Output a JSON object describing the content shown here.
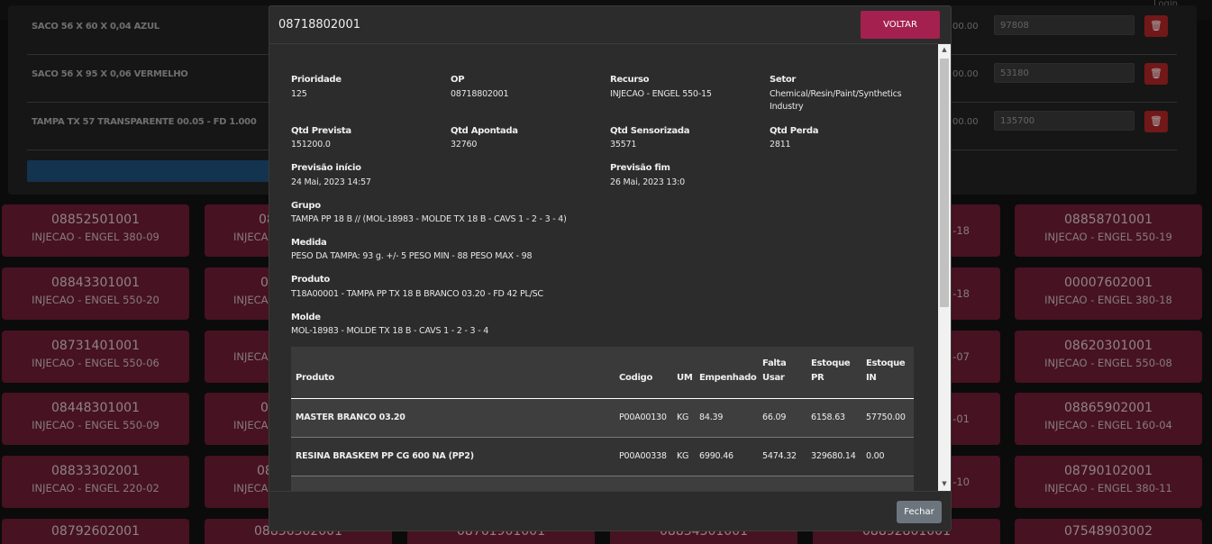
{
  "topbar": {
    "login": "Login"
  },
  "bg_rows": [
    {
      "name": "SACO 56 X 60 X 0,04 AZUL",
      "tail": "00.00",
      "input": "97808"
    },
    {
      "name": "SACO 56 X 95 X 0,06 VERMELHO",
      "tail": "00.00",
      "input": "53180"
    },
    {
      "name": "TAMPA TX 57 TRANSPARENTE 00.05 - FD 1.000",
      "tail": "00.00",
      "input": "135700"
    }
  ],
  "cards": [
    {
      "op": "08852501001",
      "res": "INJECAO - ENGEL 380-09"
    },
    {
      "op": "08",
      "res": "INJECA"
    },
    {
      "op": "",
      "res": "-18"
    },
    {
      "op": "08858701001",
      "res": "INJECAO - ENGEL 550-19"
    },
    {
      "op": "08843301001",
      "res": "INJECAO - ENGEL 550-20"
    },
    {
      "op": "0",
      "res": "INJECA"
    },
    {
      "op": "",
      "res": "-18"
    },
    {
      "op": "00007602001",
      "res": "INJECAO - ENGEL 380-18"
    },
    {
      "op": "08731401001",
      "res": "INJECAO - ENGEL 550-06"
    },
    {
      "op": "",
      "res": "INJECA"
    },
    {
      "op": "",
      "res": "-07"
    },
    {
      "op": "08620301001",
      "res": "INJECAO - ENGEL 550-08"
    },
    {
      "op": "08448301001",
      "res": "INJECAO - ENGEL 550-09"
    },
    {
      "op": "0",
      "res": "INJECA"
    },
    {
      "op": "",
      "res": "-01"
    },
    {
      "op": "08865902001",
      "res": "INJECAO - ENGEL 160-04"
    },
    {
      "op": "08833302001",
      "res": "INJECAO - ENGEL 220-02"
    },
    {
      "op": "08",
      "res": "INJECA"
    },
    {
      "op": "",
      "res": "-10"
    },
    {
      "op": "08790102001",
      "res": "INJECAO - ENGEL 380-11"
    },
    {
      "op": "08792602001",
      "res": ""
    },
    {
      "op": "08836302001",
      "res": ""
    },
    {
      "op": "08761901001",
      "res": ""
    },
    {
      "op": "08834301001",
      "res": ""
    },
    {
      "op": "08892801001",
      "res": ""
    },
    {
      "op": "07548903002",
      "res": ""
    }
  ],
  "modal": {
    "title": "08718802001",
    "voltar": "VOLTAR",
    "fechar": "Fechar",
    "scroll_up": "▲",
    "scroll_down": "▼",
    "fields": {
      "prioridade": {
        "label": "Prioridade",
        "value": "125"
      },
      "op": {
        "label": "OP",
        "value": "08718802001"
      },
      "recurso": {
        "label": "Recurso",
        "value": "INJECAO - ENGEL 550-15"
      },
      "setor": {
        "label": "Setor",
        "value": "Chemical/Resin/Paint/Synthetics Industry"
      },
      "qtd_prevista": {
        "label": "Qtd Prevista",
        "value": "151200.0"
      },
      "qtd_apontada": {
        "label": "Qtd Apontada",
        "value": "32760"
      },
      "qtd_sensorizada": {
        "label": "Qtd Sensorizada",
        "value": "35571"
      },
      "qtd_perda": {
        "label": "Qtd Perda",
        "value": "2811"
      },
      "previsao_inicio": {
        "label": "Previsão início",
        "value": "24 Mai, 2023 14:57"
      },
      "previsao_fim": {
        "label": "Previsão fim",
        "value": "26 Mai, 2023 13:0"
      },
      "grupo": {
        "label": "Grupo",
        "value": "TAMPA PP 18 B // (MOL-18983 - MOLDE TX 18 B - CAVS 1 - 2 - 3 - 4)"
      },
      "medida": {
        "label": "Medida",
        "value": "PESO DA TAMPA: 93 g. +/- 5 PESO MIN - 88 PESO MAX - 98"
      },
      "produto": {
        "label": "Produto",
        "value": "T18A00001 - TAMPA PP TX 18 B BRANCO 03.20 - FD 42 PL/SC"
      },
      "molde": {
        "label": "Molde",
        "value": "MOL-18983 - MOLDE TX 18 B - CAVS 1 - 2 - 3 - 4"
      }
    },
    "table": {
      "headers": {
        "produto": "Produto",
        "codigo": "Codigo",
        "um": "UM",
        "empenhado": "Empenhado",
        "falta_usar": "Falta Usar",
        "estoque_pr": "Estoque PR",
        "estoque_in": "Estoque IN"
      },
      "rows": [
        {
          "produto": "MASTER BRANCO 03.20",
          "codigo": "P00A00130",
          "um": "KG",
          "empenhado": "84.39",
          "falta_usar": "66.09",
          "estoque_pr": "6158.63",
          "estoque_in": "57750.00"
        },
        {
          "produto": "RESINA BRASKEM PP CG 600 NA (PP2)",
          "codigo": "P00A00338",
          "um": "KG",
          "empenhado": "6990.46",
          "falta_usar": "5474.32",
          "estoque_pr": "329680.14",
          "estoque_in": "0.00"
        }
      ]
    }
  }
}
